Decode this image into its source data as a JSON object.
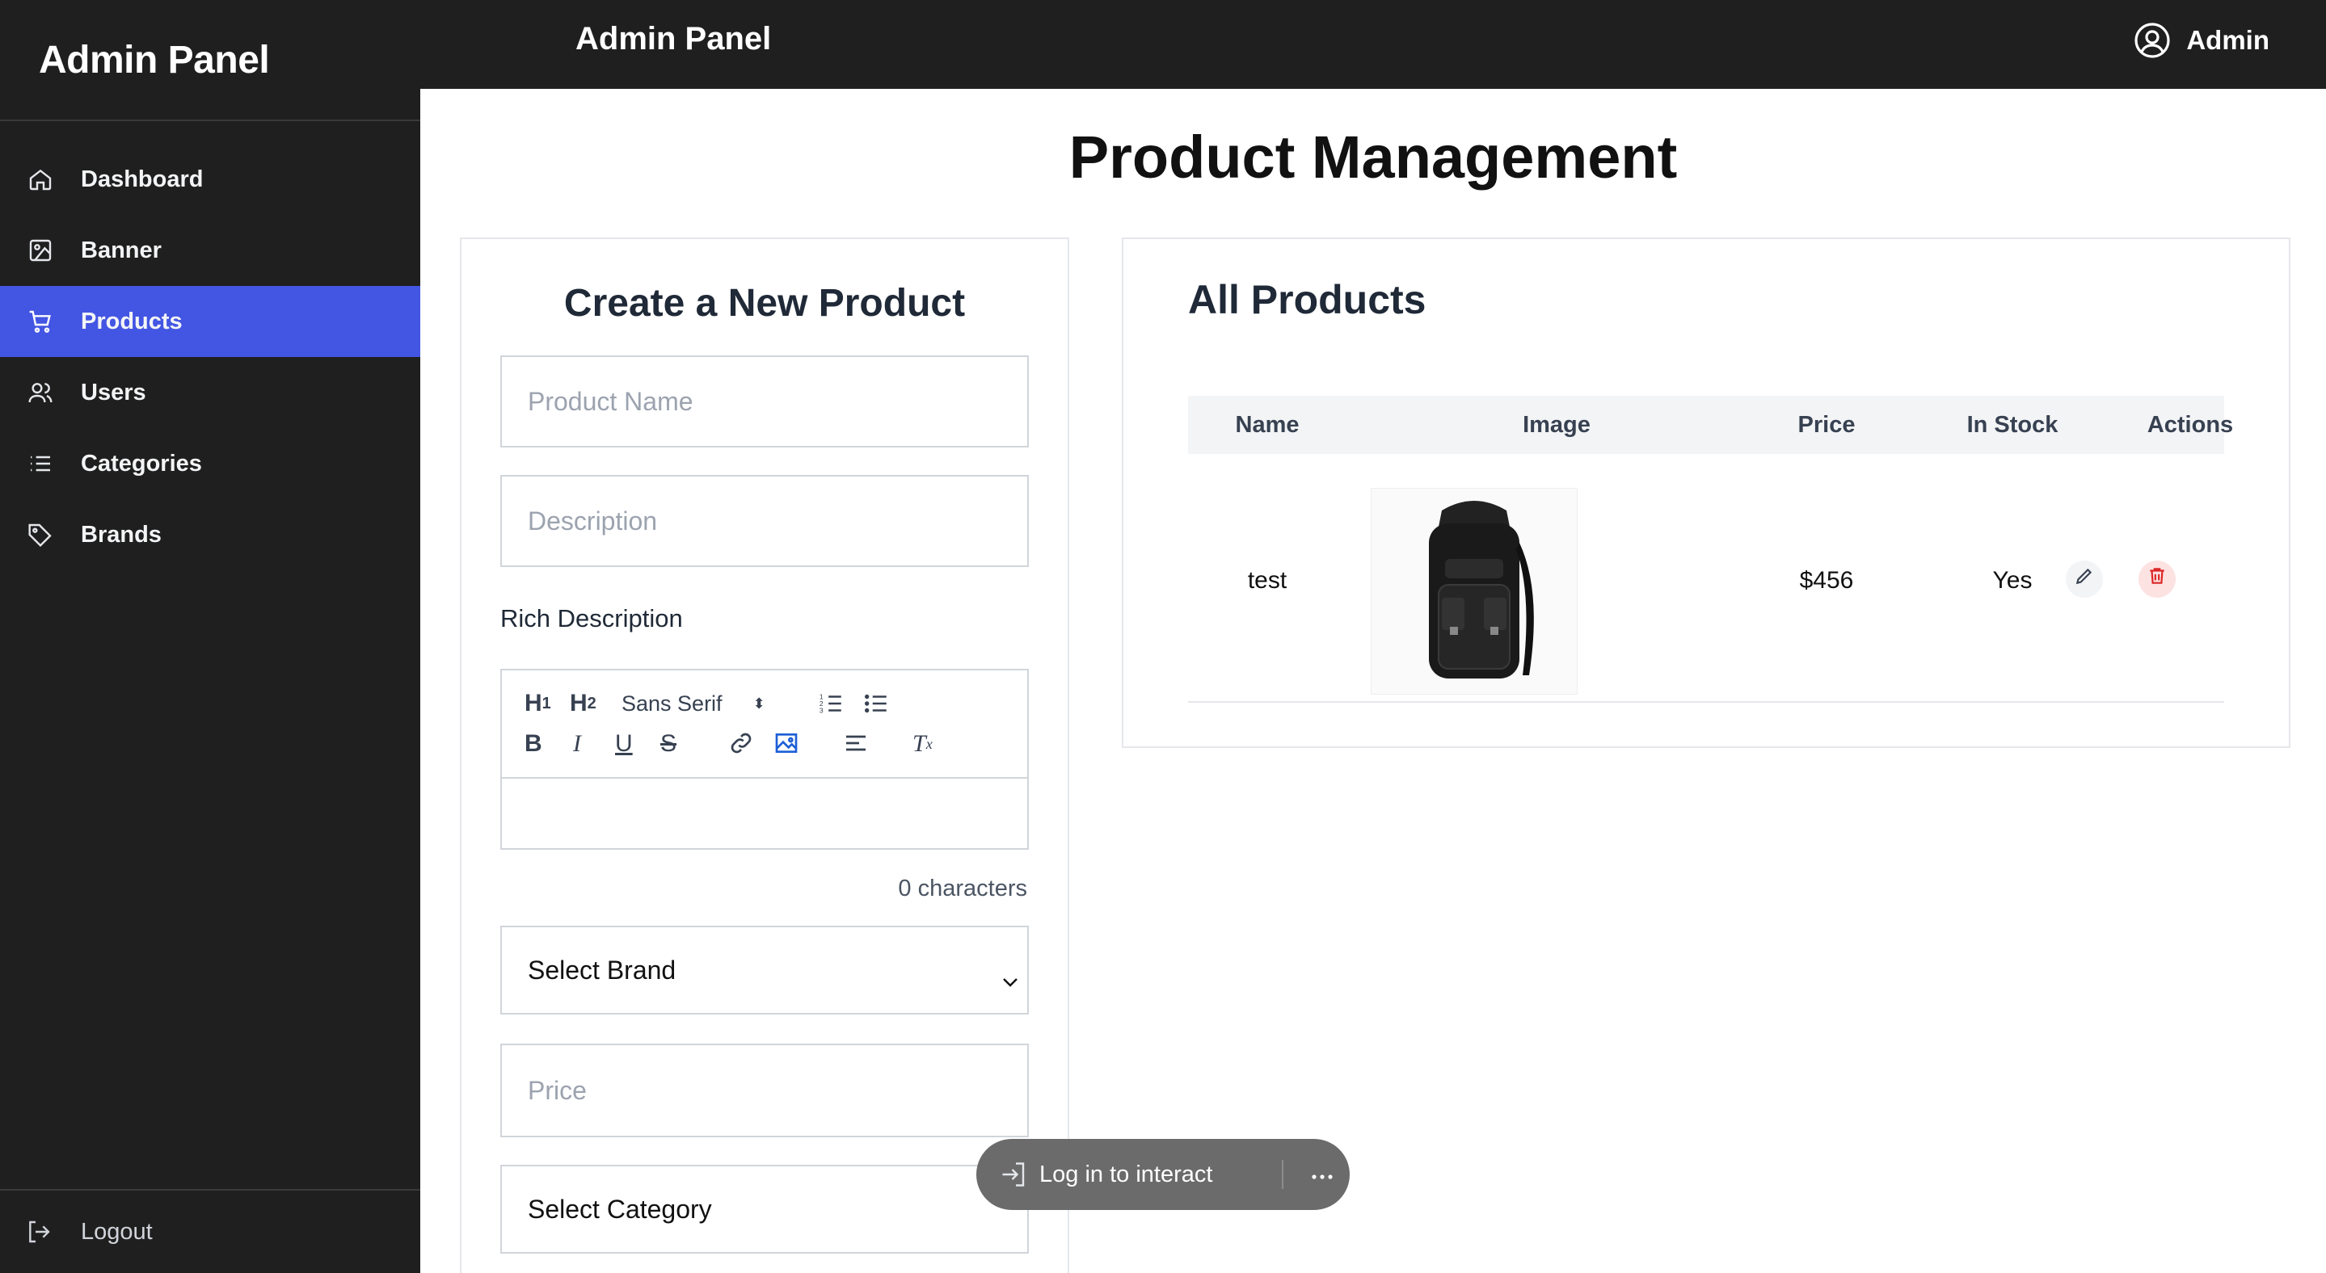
{
  "sidebar": {
    "brand": "Admin Panel",
    "items": [
      {
        "label": "Dashboard",
        "icon": "home-icon"
      },
      {
        "label": "Banner",
        "icon": "image-icon"
      },
      {
        "label": "Products",
        "icon": "cart-icon",
        "active": true
      },
      {
        "label": "Users",
        "icon": "users-icon"
      },
      {
        "label": "Categories",
        "icon": "list-icon"
      },
      {
        "label": "Brands",
        "icon": "tag-icon"
      }
    ],
    "logout": "Logout"
  },
  "topbar": {
    "title": "Admin Panel",
    "user": "Admin"
  },
  "page": {
    "title": "Product Management"
  },
  "create_form": {
    "heading": "Create a New Product",
    "product_name_placeholder": "Product Name",
    "description_placeholder": "Description",
    "rich_label": "Rich Description",
    "font_select": "Sans Serif",
    "char_count": "0 characters",
    "brand_select": "Select Brand",
    "price_placeholder": "Price",
    "category_select": "Select Category"
  },
  "products": {
    "heading": "All Products",
    "columns": [
      "Name",
      "Image",
      "Price",
      "In Stock",
      "Actions"
    ],
    "rows": [
      {
        "name": "test",
        "image": "backpack-image",
        "price": "$456",
        "in_stock": "Yes"
      }
    ]
  },
  "overlay": {
    "login_label": "Log in to interact"
  },
  "colors": {
    "sidebar_bg": "#1f1f1f",
    "active_nav": "#4355e3",
    "delete_accent": "#dc2626"
  }
}
